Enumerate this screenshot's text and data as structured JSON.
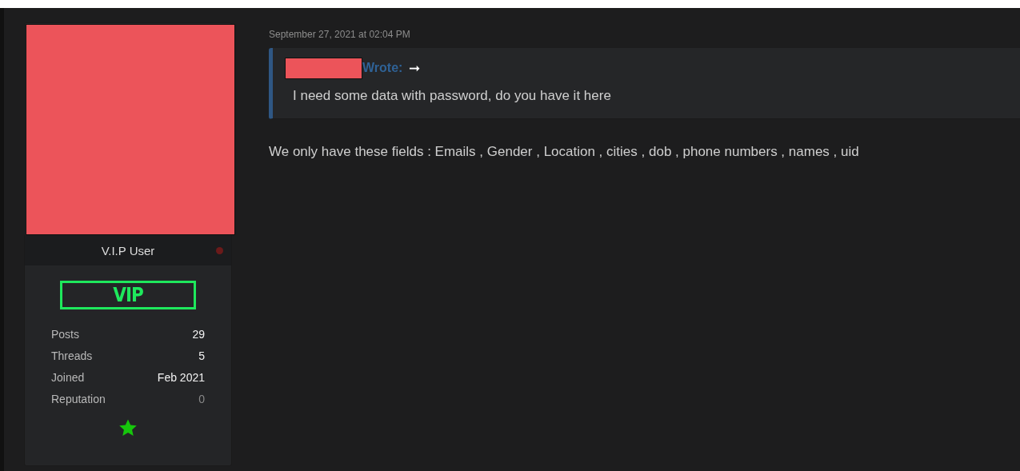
{
  "author": {
    "rank": "V.I.P User",
    "online": false,
    "badge": "VIP",
    "stats": [
      {
        "label": "Posts",
        "value": "29",
        "neutral": false
      },
      {
        "label": "Threads",
        "value": "5",
        "neutral": false
      },
      {
        "label": "Joined",
        "value": "Feb 2021",
        "neutral": false
      },
      {
        "label": "Reputation",
        "value": "0",
        "neutral": true
      }
    ]
  },
  "post": {
    "date": "September 27, 2021 at 02:04 PM",
    "quote": {
      "wrote": "Wrote:",
      "arrow": "➞",
      "text": "I need some data with password, do you have it here"
    },
    "body": "We only have these fields : Emails , Gender , Location , cities , dob , phone numbers , names , uid"
  }
}
